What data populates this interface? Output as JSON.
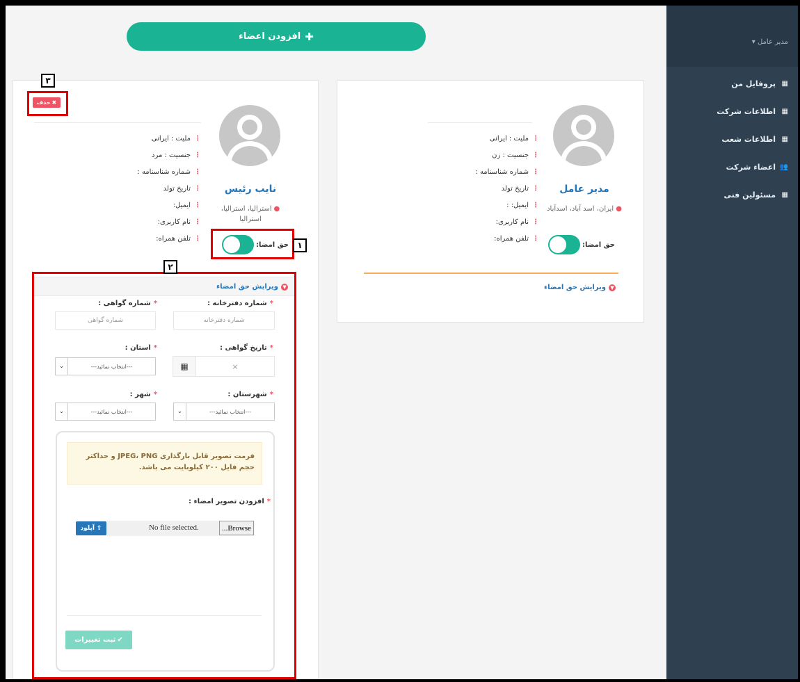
{
  "sidebar": {
    "user_menu": "مدیر عامل ▾",
    "items": [
      {
        "label": "پروفایل من",
        "icon": "grid-icon"
      },
      {
        "label": "اطلاعات شرکت",
        "icon": "grid-icon"
      },
      {
        "label": "اطلاعات شعب",
        "icon": "grid-icon"
      },
      {
        "label": "اعضاء شرکت",
        "icon": "users-icon"
      },
      {
        "label": "مسئولین فنی",
        "icon": "grid-icon"
      }
    ]
  },
  "header": {
    "add_members_label": "افزودن اعضاء"
  },
  "members": [
    {
      "name": "مدیر عامل",
      "location": "ایران، اسد آباد، اسدآباد",
      "signature_toggle_label": "حق امضا:",
      "fields": [
        "ملیت : ایرانی",
        "جنسیت : زن",
        "شماره شناسنامه :",
        "تاریخ تولد",
        "ایمیل: :",
        "نام کاربری:",
        "تلفن همراه:"
      ],
      "edit_link": "ویرایش حق امضاء"
    },
    {
      "name": "نایب رئیس",
      "location": "استرالیا، استرالیا، استرالیا",
      "signature_toggle_label": "حق امضا:",
      "fields": [
        "ملیت : ایرانی",
        "جنسیت : مرد",
        "شماره شناسنامه :",
        "تاریخ تولد",
        "ایمیل:",
        "نام کاربری:",
        "تلفن همراه:"
      ],
      "edit_link": "ویرایش حق امضاء",
      "delete_label": "حذف"
    }
  ],
  "form": {
    "notary_label": "شماره دفترخانه :",
    "notary_placeholder": "شماره دفترخانه",
    "cert_label": "شماره گواهی :",
    "cert_placeholder": "شماره گواهی",
    "cert_date_label": "تاریخ گواهی :",
    "clear_symbol": "×",
    "province_label": "استان :",
    "county_label": "شهرستان :",
    "city_label": "شهر :",
    "select_placeholder": "---انتخاب نمائید---",
    "alert_text": "فرمت تصویر قابل بارگذاری JPEG، PNG و حداکثر حجم فایل ۲۰۰ کیلوبایت می باشد.",
    "add_signature_label": "افزودن تصویر امضاء :",
    "browse_label": "Browse...",
    "file_status": "No file selected.",
    "upload_label": "آپلود",
    "submit_label": "ثبت تغییرات"
  },
  "annotations": [
    "۱",
    "۲",
    "۳"
  ],
  "colors": {
    "sidebar": "#2f4050",
    "primary": "#1ab394",
    "danger": "#ed5565",
    "link": "#2676b8",
    "annotation": "#e00000"
  }
}
